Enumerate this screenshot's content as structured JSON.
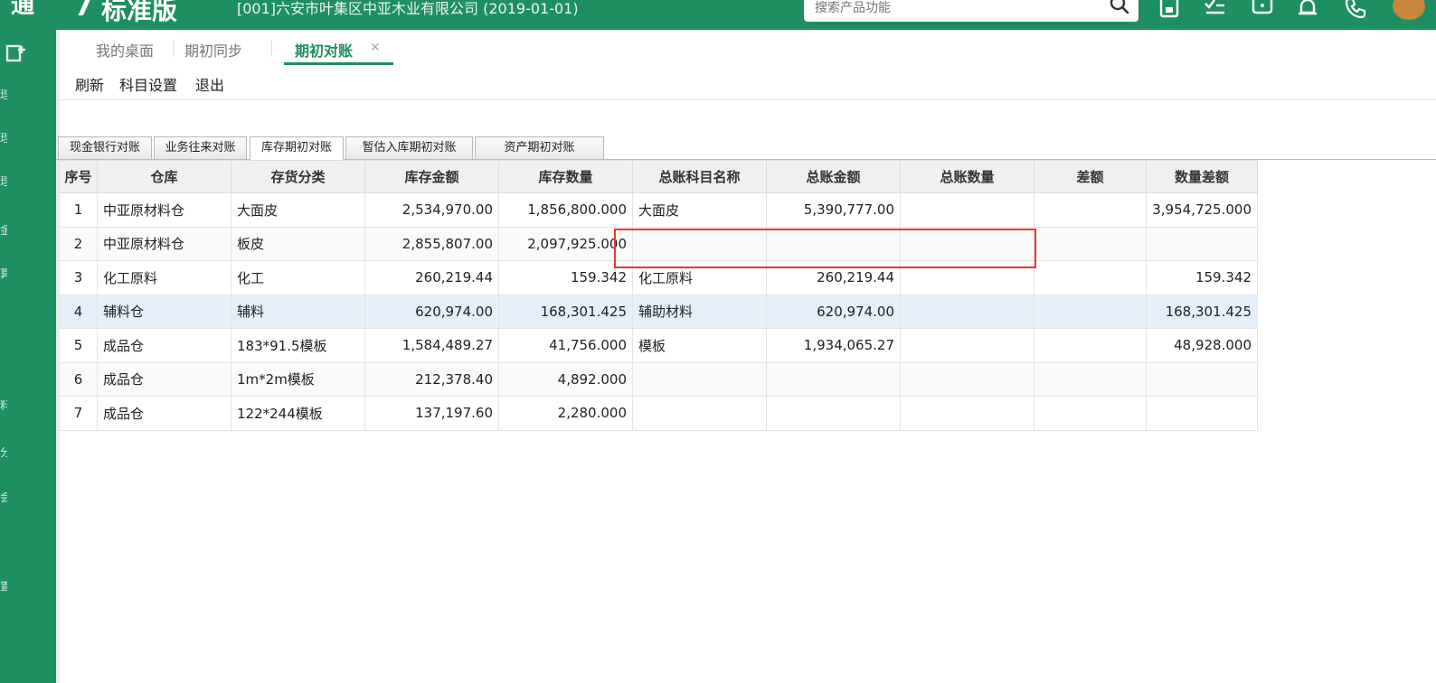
{
  "header": {
    "logo": "通",
    "version_mark": "7",
    "edition": "标准版",
    "company": "[001]六安市叶集区中亚木业有限公司  (2019-01-01)",
    "search_placeholder": "搜索产品功能"
  },
  "colors": {
    "brand": "#1e8f61",
    "highlight": "#e53935",
    "selected_row": "#e4eff9"
  },
  "icons": [
    "search-icon",
    "save-icon",
    "checklist-icon",
    "message-icon",
    "bell-icon",
    "phone-icon",
    "avatar",
    "add-icon"
  ],
  "tabs": [
    {
      "label": "我的桌面"
    },
    {
      "label": "期初同步"
    },
    {
      "label": "期初对账",
      "active": true
    }
  ],
  "toolbar": {
    "refresh": "刷新",
    "subject_settings": "科目设置",
    "exit": "退出"
  },
  "subtabs": [
    {
      "label": "现金银行对账"
    },
    {
      "label": "业务往来对账"
    },
    {
      "label": "库存期初对账",
      "active": true
    },
    {
      "label": "暂估入库期初对账"
    },
    {
      "label": "资产期初对账"
    }
  ],
  "table": {
    "columns": [
      "序号",
      "仓库",
      "存货分类",
      "库存金额",
      "库存数量",
      "总账科目名称",
      "总账金额",
      "总账数量",
      "差额",
      "数量差额"
    ],
    "rows": [
      [
        "1",
        "中亚原材料仓",
        "大面皮",
        "2,534,970.00",
        "1,856,800.000",
        "大面皮",
        "5,390,777.00",
        "",
        "",
        "3,954,725.000"
      ],
      [
        "2",
        "中亚原材料仓",
        "板皮",
        "2,855,807.00",
        "2,097,925.000",
        "",
        "",
        "",
        "",
        ""
      ],
      [
        "3",
        "化工原料",
        "化工",
        "260,219.44",
        "159.342",
        "化工原料",
        "260,219.44",
        "",
        "",
        "159.342"
      ],
      [
        "4",
        "辅料仓",
        "辅料",
        "620,974.00",
        "168,301.425",
        "辅助材料",
        "620,974.00",
        "",
        "",
        "168,301.425"
      ],
      [
        "5",
        "成品仓",
        "183*91.5模板",
        "1,584,489.27",
        "41,756.000",
        "模板",
        "1,934,065.27",
        "",
        "",
        "48,928.000"
      ],
      [
        "6",
        "成品仓",
        "1m*2m模板",
        "212,378.40",
        "4,892.000",
        "",
        "",
        "",
        "",
        ""
      ],
      [
        "7",
        "成品仓",
        "122*244模板",
        "137,197.60",
        "2,280.000",
        "",
        "",
        "",
        "",
        ""
      ]
    ],
    "selected_row": 4
  }
}
